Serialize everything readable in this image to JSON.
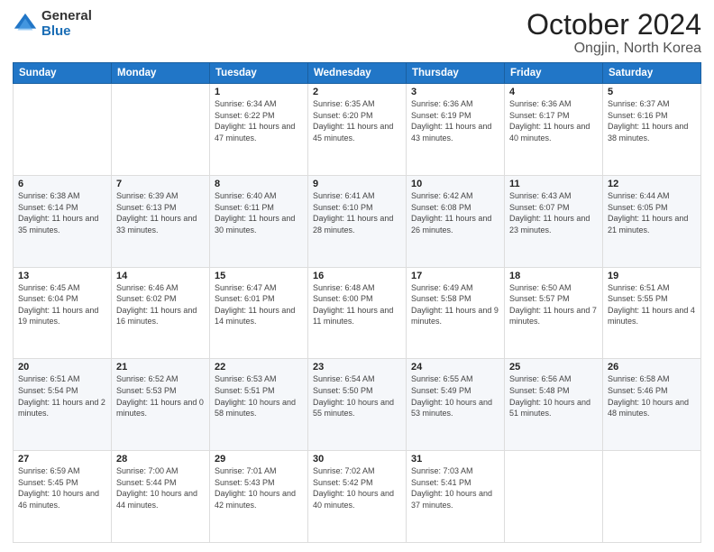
{
  "header": {
    "logo_general": "General",
    "logo_blue": "Blue",
    "month_title": "October 2024",
    "location": "Ongjin, North Korea"
  },
  "days_of_week": [
    "Sunday",
    "Monday",
    "Tuesday",
    "Wednesday",
    "Thursday",
    "Friday",
    "Saturday"
  ],
  "weeks": [
    [
      {
        "day": "",
        "info": ""
      },
      {
        "day": "",
        "info": ""
      },
      {
        "day": "1",
        "info": "Sunrise: 6:34 AM\nSunset: 6:22 PM\nDaylight: 11 hours and 47 minutes."
      },
      {
        "day": "2",
        "info": "Sunrise: 6:35 AM\nSunset: 6:20 PM\nDaylight: 11 hours and 45 minutes."
      },
      {
        "day": "3",
        "info": "Sunrise: 6:36 AM\nSunset: 6:19 PM\nDaylight: 11 hours and 43 minutes."
      },
      {
        "day": "4",
        "info": "Sunrise: 6:36 AM\nSunset: 6:17 PM\nDaylight: 11 hours and 40 minutes."
      },
      {
        "day": "5",
        "info": "Sunrise: 6:37 AM\nSunset: 6:16 PM\nDaylight: 11 hours and 38 minutes."
      }
    ],
    [
      {
        "day": "6",
        "info": "Sunrise: 6:38 AM\nSunset: 6:14 PM\nDaylight: 11 hours and 35 minutes."
      },
      {
        "day": "7",
        "info": "Sunrise: 6:39 AM\nSunset: 6:13 PM\nDaylight: 11 hours and 33 minutes."
      },
      {
        "day": "8",
        "info": "Sunrise: 6:40 AM\nSunset: 6:11 PM\nDaylight: 11 hours and 30 minutes."
      },
      {
        "day": "9",
        "info": "Sunrise: 6:41 AM\nSunset: 6:10 PM\nDaylight: 11 hours and 28 minutes."
      },
      {
        "day": "10",
        "info": "Sunrise: 6:42 AM\nSunset: 6:08 PM\nDaylight: 11 hours and 26 minutes."
      },
      {
        "day": "11",
        "info": "Sunrise: 6:43 AM\nSunset: 6:07 PM\nDaylight: 11 hours and 23 minutes."
      },
      {
        "day": "12",
        "info": "Sunrise: 6:44 AM\nSunset: 6:05 PM\nDaylight: 11 hours and 21 minutes."
      }
    ],
    [
      {
        "day": "13",
        "info": "Sunrise: 6:45 AM\nSunset: 6:04 PM\nDaylight: 11 hours and 19 minutes."
      },
      {
        "day": "14",
        "info": "Sunrise: 6:46 AM\nSunset: 6:02 PM\nDaylight: 11 hours and 16 minutes."
      },
      {
        "day": "15",
        "info": "Sunrise: 6:47 AM\nSunset: 6:01 PM\nDaylight: 11 hours and 14 minutes."
      },
      {
        "day": "16",
        "info": "Sunrise: 6:48 AM\nSunset: 6:00 PM\nDaylight: 11 hours and 11 minutes."
      },
      {
        "day": "17",
        "info": "Sunrise: 6:49 AM\nSunset: 5:58 PM\nDaylight: 11 hours and 9 minutes."
      },
      {
        "day": "18",
        "info": "Sunrise: 6:50 AM\nSunset: 5:57 PM\nDaylight: 11 hours and 7 minutes."
      },
      {
        "day": "19",
        "info": "Sunrise: 6:51 AM\nSunset: 5:55 PM\nDaylight: 11 hours and 4 minutes."
      }
    ],
    [
      {
        "day": "20",
        "info": "Sunrise: 6:51 AM\nSunset: 5:54 PM\nDaylight: 11 hours and 2 minutes."
      },
      {
        "day": "21",
        "info": "Sunrise: 6:52 AM\nSunset: 5:53 PM\nDaylight: 11 hours and 0 minutes."
      },
      {
        "day": "22",
        "info": "Sunrise: 6:53 AM\nSunset: 5:51 PM\nDaylight: 10 hours and 58 minutes."
      },
      {
        "day": "23",
        "info": "Sunrise: 6:54 AM\nSunset: 5:50 PM\nDaylight: 10 hours and 55 minutes."
      },
      {
        "day": "24",
        "info": "Sunrise: 6:55 AM\nSunset: 5:49 PM\nDaylight: 10 hours and 53 minutes."
      },
      {
        "day": "25",
        "info": "Sunrise: 6:56 AM\nSunset: 5:48 PM\nDaylight: 10 hours and 51 minutes."
      },
      {
        "day": "26",
        "info": "Sunrise: 6:58 AM\nSunset: 5:46 PM\nDaylight: 10 hours and 48 minutes."
      }
    ],
    [
      {
        "day": "27",
        "info": "Sunrise: 6:59 AM\nSunset: 5:45 PM\nDaylight: 10 hours and 46 minutes."
      },
      {
        "day": "28",
        "info": "Sunrise: 7:00 AM\nSunset: 5:44 PM\nDaylight: 10 hours and 44 minutes."
      },
      {
        "day": "29",
        "info": "Sunrise: 7:01 AM\nSunset: 5:43 PM\nDaylight: 10 hours and 42 minutes."
      },
      {
        "day": "30",
        "info": "Sunrise: 7:02 AM\nSunset: 5:42 PM\nDaylight: 10 hours and 40 minutes."
      },
      {
        "day": "31",
        "info": "Sunrise: 7:03 AM\nSunset: 5:41 PM\nDaylight: 10 hours and 37 minutes."
      },
      {
        "day": "",
        "info": ""
      },
      {
        "day": "",
        "info": ""
      }
    ]
  ]
}
